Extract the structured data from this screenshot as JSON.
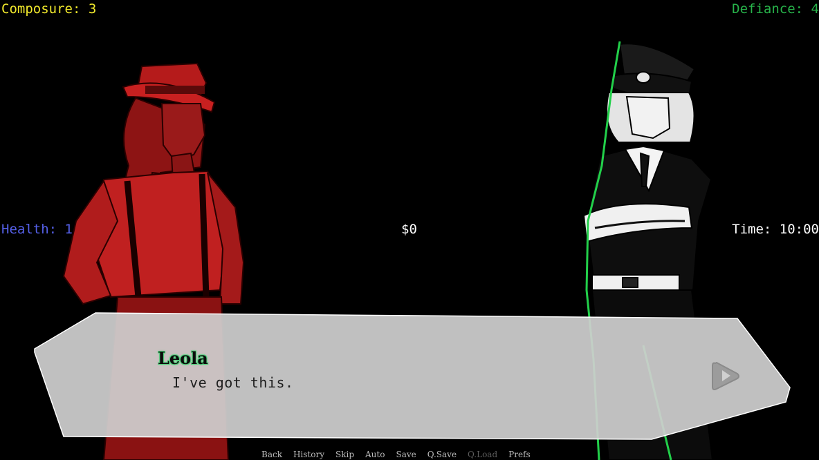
{
  "stats": {
    "composure": "Composure: 3",
    "defiance": "Defiance: 4",
    "health": "Health: 1",
    "money": "$0",
    "time": "Time: 10:00"
  },
  "colors": {
    "composure": "#f2ea2c",
    "defiance": "#27b34a",
    "health": "#5560e8",
    "leola_tint": "#c01818",
    "officer_outline": "#22d04a",
    "textbox": "#c8c8c8"
  },
  "dialogue": {
    "speaker": "Leola",
    "text": "I've got this.",
    "advance_icon": "play-triangle-icon"
  },
  "quick_menu": [
    {
      "label": "Back",
      "enabled": true
    },
    {
      "label": "History",
      "enabled": true
    },
    {
      "label": "Skip",
      "enabled": true
    },
    {
      "label": "Auto",
      "enabled": true
    },
    {
      "label": "Save",
      "enabled": true
    },
    {
      "label": "Q.Save",
      "enabled": true
    },
    {
      "label": "Q.Load",
      "enabled": false
    },
    {
      "label": "Prefs",
      "enabled": true
    }
  ]
}
